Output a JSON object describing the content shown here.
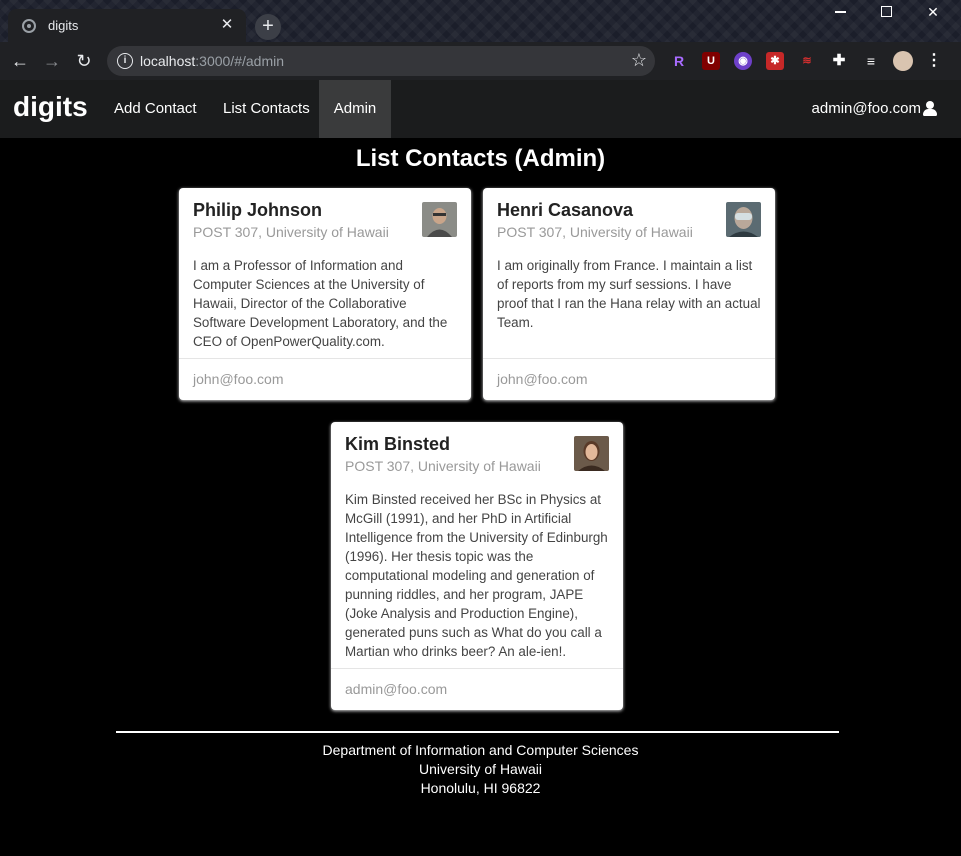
{
  "browser": {
    "tab_title": "digits",
    "url_host": "localhost",
    "url_rest": ":3000/#/admin",
    "info_icon": "i"
  },
  "navbar": {
    "brand": "digits",
    "items": [
      {
        "label": "Add Contact"
      },
      {
        "label": "List Contacts"
      },
      {
        "label": "Admin"
      }
    ],
    "user": "admin@foo.com"
  },
  "page": {
    "title": "List Contacts (Admin)"
  },
  "contacts": [
    {
      "name": "Philip Johnson",
      "address": "POST 307, University of Hawaii",
      "description": "I am a Professor of Information and Computer Sciences at the University of Hawaii, Director of the Collaborative Software Development Laboratory, and the CEO of OpenPowerQuality.com.",
      "owner": "john@foo.com"
    },
    {
      "name": "Henri Casanova",
      "address": "POST 307, University of Hawaii",
      "description": "I am originally from France. I maintain a list of reports from my surf sessions. I have proof that I ran the Hana relay with an actual Team.",
      "owner": "john@foo.com"
    },
    {
      "name": "Kim Binsted",
      "address": "POST 307, University of Hawaii",
      "description": "Kim Binsted received her BSc in Physics at McGill (1991), and her PhD in Artificial Intelligence from the University of Edinburgh (1996). Her thesis topic was the computational modeling and generation of punning riddles, and her program, JAPE (Joke Analysis and Production Engine), generated puns such as What do you call a Martian who drinks beer? An ale-ien!.",
      "owner": "admin@foo.com"
    }
  ],
  "footer": {
    "line1": "Department of Information and Computer Sciences",
    "line2": "University of Hawaii",
    "line3": "Honolulu, HI 96822"
  }
}
